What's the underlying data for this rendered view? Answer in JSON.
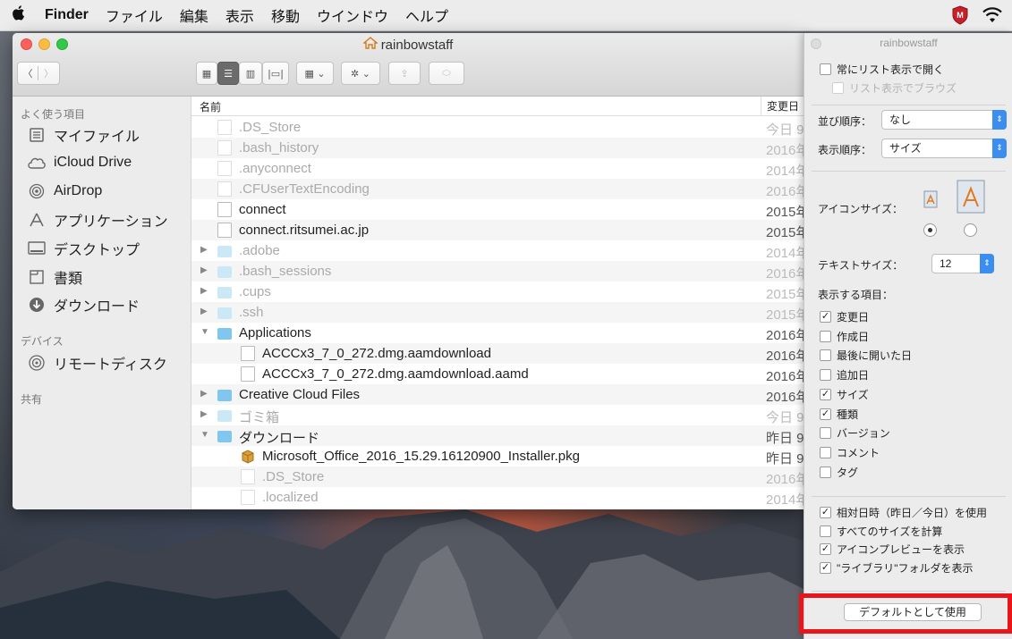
{
  "menubar": {
    "app": "Finder",
    "items": [
      "ファイル",
      "編集",
      "表示",
      "移動",
      "ウインドウ",
      "ヘルプ"
    ]
  },
  "window": {
    "title": "rainbowstaff"
  },
  "sidebar": {
    "favorites_heading": "よく使う項目",
    "favorites": [
      {
        "label": "マイファイル",
        "icon": "all-my-files-icon"
      },
      {
        "label": "iCloud Drive",
        "icon": "cloud-icon"
      },
      {
        "label": "AirDrop",
        "icon": "airdrop-icon"
      },
      {
        "label": "アプリケーション",
        "icon": "applications-icon"
      },
      {
        "label": "デスクトップ",
        "icon": "desktop-icon"
      },
      {
        "label": "書類",
        "icon": "documents-icon"
      },
      {
        "label": "ダウンロード",
        "icon": "downloads-icon"
      }
    ],
    "devices_heading": "デバイス",
    "devices": [
      {
        "label": "リモートディスク",
        "icon": "remote-disc-icon"
      }
    ],
    "shared_heading": "共有"
  },
  "filelist": {
    "columns": {
      "name": "名前",
      "modified": "変更日"
    },
    "rows": [
      {
        "name": ".DS_Store",
        "date": "今日 9:",
        "type": "doc",
        "dim": true,
        "indent": 0,
        "arrow": ""
      },
      {
        "name": ".bash_history",
        "date": "2016年",
        "type": "doc",
        "dim": true,
        "indent": 0,
        "arrow": ""
      },
      {
        "name": ".anyconnect",
        "date": "2014年",
        "type": "doc",
        "dim": true,
        "indent": 0,
        "arrow": ""
      },
      {
        "name": ".CFUserTextEncoding",
        "date": "2016年",
        "type": "doc",
        "dim": true,
        "indent": 0,
        "arrow": ""
      },
      {
        "name": "connect",
        "date": "2015年",
        "type": "doc",
        "dim": false,
        "indent": 0,
        "arrow": ""
      },
      {
        "name": "connect.ritsumei.ac.jp",
        "date": "2015年",
        "type": "doc",
        "dim": false,
        "indent": 0,
        "arrow": ""
      },
      {
        "name": ".adobe",
        "date": "2014年",
        "type": "folder",
        "dim": true,
        "indent": 0,
        "arrow": "▶"
      },
      {
        "name": ".bash_sessions",
        "date": "2016年",
        "type": "folder",
        "dim": true,
        "indent": 0,
        "arrow": "▶"
      },
      {
        "name": ".cups",
        "date": "2015年",
        "type": "folder",
        "dim": true,
        "indent": 0,
        "arrow": "▶"
      },
      {
        "name": ".ssh",
        "date": "2015年",
        "type": "folder",
        "dim": true,
        "indent": 0,
        "arrow": "▶"
      },
      {
        "name": "Applications",
        "date": "2016年",
        "type": "folder",
        "dim": false,
        "indent": 0,
        "arrow": "▼"
      },
      {
        "name": "ACCCx3_7_0_272.dmg.aamdownload",
        "date": "2016年",
        "type": "doc",
        "dim": false,
        "indent": 1,
        "arrow": ""
      },
      {
        "name": "ACCCx3_7_0_272.dmg.aamdownload.aamd",
        "date": "2016年",
        "type": "doc",
        "dim": false,
        "indent": 1,
        "arrow": ""
      },
      {
        "name": "Creative Cloud Files",
        "date": "2016年",
        "type": "folder",
        "dim": false,
        "indent": 0,
        "arrow": "▶"
      },
      {
        "name": "ゴミ箱",
        "date": "今日 9:",
        "type": "folder",
        "dim": true,
        "indent": 0,
        "arrow": "▶"
      },
      {
        "name": "ダウンロード",
        "date": "昨日 9:",
        "type": "folder",
        "dim": false,
        "indent": 0,
        "arrow": "▼"
      },
      {
        "name": "Microsoft_Office_2016_15.29.16120900_Installer.pkg",
        "date": "昨日 9:",
        "type": "pkg",
        "dim": false,
        "indent": 1,
        "arrow": ""
      },
      {
        "name": ".DS_Store",
        "date": "2016年",
        "type": "doc",
        "dim": true,
        "indent": 1,
        "arrow": ""
      },
      {
        "name": ".localized",
        "date": "2014年",
        "type": "doc",
        "dim": true,
        "indent": 1,
        "arrow": ""
      }
    ]
  },
  "view_options": {
    "title": "rainbowstaff",
    "always_list": "常にリスト表示で開く",
    "browse_list": "リスト表示でブラウズ",
    "arrange_label": "並び順序：",
    "arrange_value": "なし",
    "sort_label": "表示順序：",
    "sort_value": "サイズ",
    "icon_size_label": "アイコンサイズ：",
    "text_size_label": "テキストサイズ：",
    "text_size_value": "12",
    "show_columns_label": "表示する項目：",
    "columns": [
      {
        "label": "変更日",
        "checked": true
      },
      {
        "label": "作成日",
        "checked": false
      },
      {
        "label": "最後に開いた日",
        "checked": false
      },
      {
        "label": "追加日",
        "checked": false
      },
      {
        "label": "サイズ",
        "checked": true
      },
      {
        "label": "種類",
        "checked": true
      },
      {
        "label": "バージョン",
        "checked": false
      },
      {
        "label": "コメント",
        "checked": false
      },
      {
        "label": "タグ",
        "checked": false
      }
    ],
    "options": [
      {
        "label": "相対日時（昨日／今日）を使用",
        "checked": true
      },
      {
        "label": "すべてのサイズを計算",
        "checked": false
      },
      {
        "label": "アイコンプレビューを表示",
        "checked": true
      },
      {
        "label": "\"ライブラリ\"フォルダを表示",
        "checked": true
      }
    ],
    "default_button": "デフォルトとして使用"
  },
  "colors": {
    "highlight": "#e8151c",
    "accent": "#3b8ef0",
    "folder": "#7fc7ef"
  }
}
